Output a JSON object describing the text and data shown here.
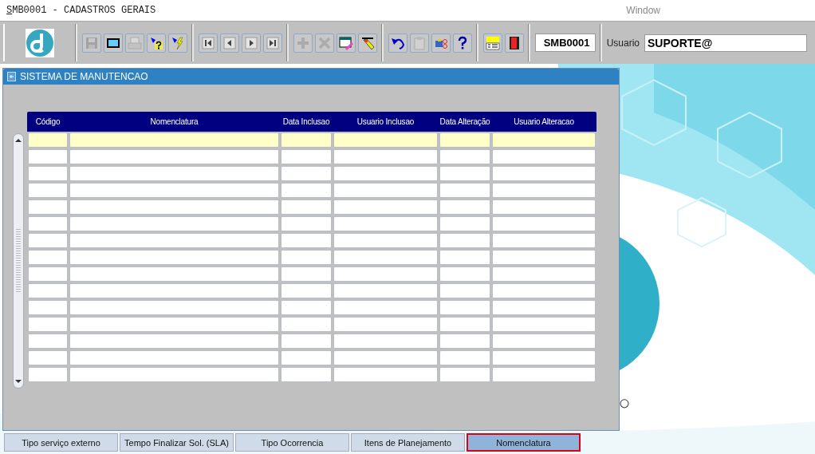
{
  "window": {
    "title": "SMB0001 - CADASTROS GERAIS",
    "menu": "Window"
  },
  "toolbar": {
    "groups": [
      [
        {
          "kind": "save",
          "disabled": true
        },
        {
          "kind": "window",
          "disabled": false
        },
        {
          "kind": "print",
          "disabled": true
        },
        {
          "kind": "query",
          "disabled": false
        },
        {
          "kind": "execute",
          "disabled": false
        }
      ],
      [
        {
          "kind": "first",
          "disabled": false
        },
        {
          "kind": "prev",
          "disabled": false
        },
        {
          "kind": "next",
          "disabled": false
        },
        {
          "kind": "last",
          "disabled": false
        }
      ],
      [
        {
          "kind": "add",
          "disabled": true
        },
        {
          "kind": "delete",
          "disabled": true
        },
        {
          "kind": "edit",
          "disabled": false
        },
        {
          "kind": "clear",
          "disabled": false
        }
      ],
      [
        {
          "kind": "undo",
          "disabled": false
        },
        {
          "kind": "paste",
          "disabled": true
        },
        {
          "kind": "list",
          "disabled": false
        },
        {
          "kind": "help",
          "disabled": false
        }
      ],
      [
        {
          "kind": "menu",
          "disabled": false
        },
        {
          "kind": "exit",
          "disabled": false
        }
      ]
    ],
    "form_code": "SMB0001",
    "user_label": "Usuario",
    "user_value": "SUPORTE@"
  },
  "panel": {
    "title": "SISTEMA DE MANUTENCAO"
  },
  "table": {
    "columns": [
      "Código",
      "Nomenclatura",
      "Data Inclusao",
      "Usuario Inclusao",
      "Data Alteração",
      "Usuario Alteracao"
    ],
    "rows": [
      {
        "selected": true
      },
      {
        "selected": false
      },
      {
        "selected": false
      },
      {
        "selected": false
      },
      {
        "selected": false
      },
      {
        "selected": false
      },
      {
        "selected": false
      },
      {
        "selected": false
      },
      {
        "selected": false
      },
      {
        "selected": false
      },
      {
        "selected": false
      },
      {
        "selected": false
      },
      {
        "selected": false
      },
      {
        "selected": false
      },
      {
        "selected": false
      }
    ]
  },
  "tabs": [
    {
      "label": "Tipo serviço externo",
      "selected": false
    },
    {
      "label": "Tempo Finalizar Sol. (SLA)",
      "selected": false
    },
    {
      "label": "Tipo Ocorrencia",
      "selected": false
    },
    {
      "label": "Itens de Planejamento",
      "selected": false
    },
    {
      "label": "Nomenclatura",
      "selected": true
    }
  ]
}
